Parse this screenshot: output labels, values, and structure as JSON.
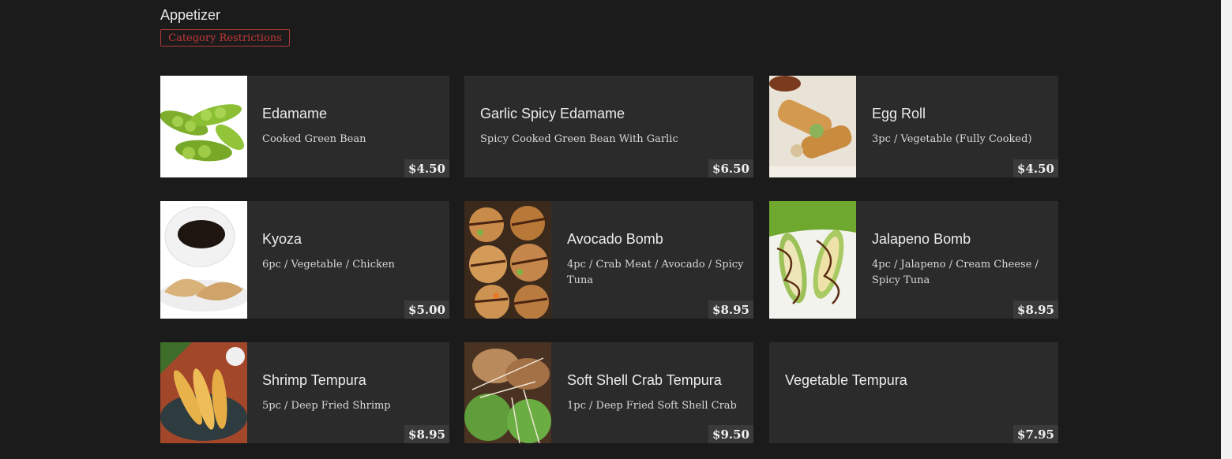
{
  "category": {
    "title": "Appetizer",
    "restrictions_label": "Category Restrictions"
  },
  "items": [
    {
      "name": "Edamame",
      "description": "Cooked Green Bean",
      "price": "$4.50",
      "image": "edamame-photo"
    },
    {
      "name": "Garlic Spicy Edamame",
      "description": "Spicy Cooked Green Bean With Garlic",
      "price": "$6.50",
      "image": null
    },
    {
      "name": "Egg Roll",
      "description": "3pc / Vegetable (Fully Cooked)",
      "price": "$4.50",
      "image": "egg-roll-photo"
    },
    {
      "name": "Kyoza",
      "description": "6pc / Vegetable / Chicken",
      "price": "$5.00",
      "image": "gyoza-photo"
    },
    {
      "name": "Avocado Bomb",
      "description": "4pc / Crab Meat / Avocado / Spicy Tuna",
      "price": "$8.95",
      "image": "avocado-bomb-photo"
    },
    {
      "name": "Jalapeno Bomb",
      "description": "4pc / Jalapeno / Cream Cheese / Spicy Tuna",
      "price": "$8.95",
      "image": "jalapeno-bomb-photo"
    },
    {
      "name": "Shrimp Tempura",
      "description": "5pc / Deep Fried Shrimp",
      "price": "$8.95",
      "image": "shrimp-tempura-photo"
    },
    {
      "name": "Soft Shell Crab Tempura",
      "description": "1pc / Deep Fried Soft Shell Crab",
      "price": "$9.50",
      "image": "soft-shell-crab-photo"
    },
    {
      "name": "Vegetable Tempura",
      "description": "",
      "price": "$7.95",
      "image": null
    }
  ],
  "colors": {
    "background": "#1b1b1b",
    "card": "#2b2b2b",
    "accent": "#c0393b"
  }
}
